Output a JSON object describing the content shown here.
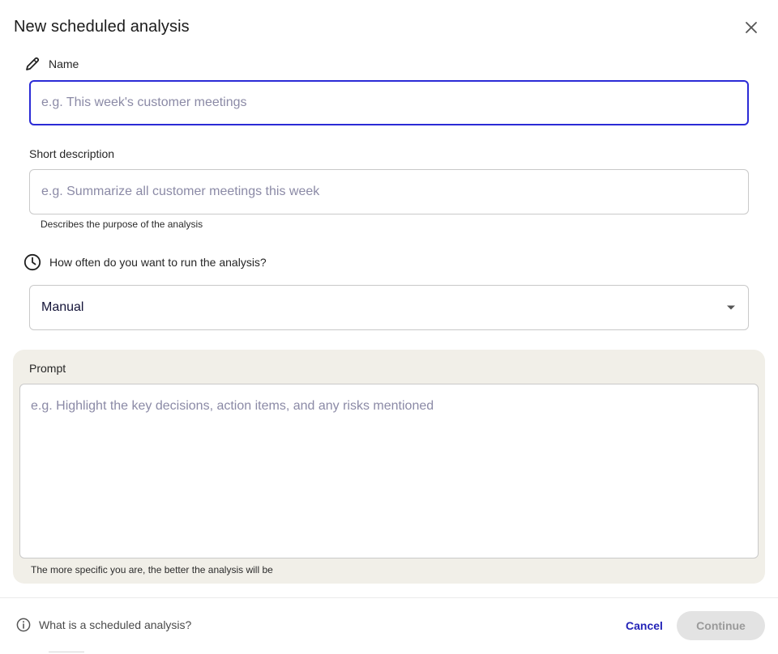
{
  "dialog": {
    "title": "New scheduled analysis",
    "close_icon": "close-icon"
  },
  "name_field": {
    "icon": "pencil-icon",
    "label": "Name",
    "placeholder": "e.g. This week's customer meetings",
    "value": ""
  },
  "description_field": {
    "label": "Short description",
    "placeholder": "e.g. Summarize all customer meetings this week",
    "value": "",
    "helper": "Describes the purpose of the analysis"
  },
  "frequency_field": {
    "icon": "clock-icon",
    "label": "How often do you want to run the analysis?",
    "selected": "Manual",
    "dropdown_icon": "caret-down-icon"
  },
  "prompt_field": {
    "label": "Prompt",
    "placeholder": "e.g. Highlight the key decisions, action items, and any risks mentioned",
    "value": "",
    "helper": "The more specific you are, the better the analysis will be"
  },
  "footer": {
    "info_icon": "info-icon",
    "info_text": "What is a scheduled analysis?",
    "cancel_label": "Cancel",
    "continue_label": "Continue"
  },
  "colors": {
    "accent": "#2b2bd6",
    "link": "#2424b8",
    "prompt_panel_bg": "#f1efe8",
    "disabled_button_bg": "#e3e3e3"
  }
}
